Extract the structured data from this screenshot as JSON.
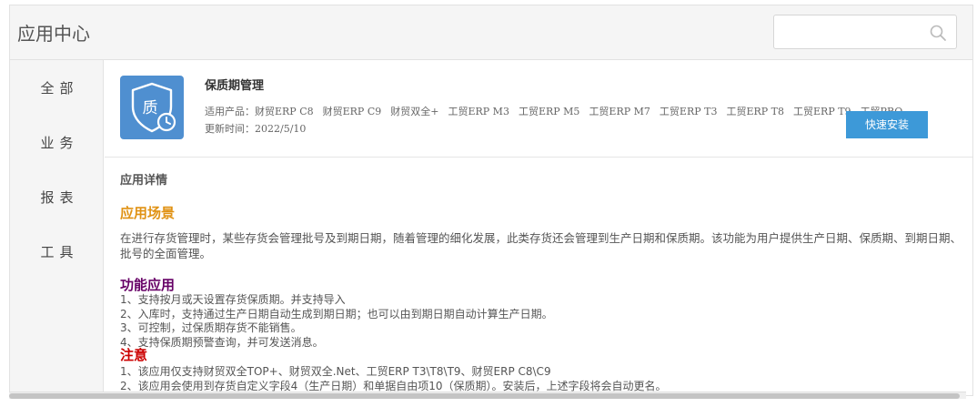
{
  "header": {
    "title": "应用中心",
    "search_placeholder": ""
  },
  "sidebar": {
    "items": [
      {
        "label": "全部"
      },
      {
        "label": "业务"
      },
      {
        "label": "报表"
      },
      {
        "label": "工具"
      }
    ]
  },
  "app": {
    "icon_char": "质",
    "name": "保质期管理",
    "products_label": "适用产品：",
    "products": [
      "财贸ERP C8",
      "财贸ERP C9",
      "财贸双全+",
      "工贸ERP M3",
      "工贸ERP M5",
      "工贸ERP M7",
      "工贸ERP T3",
      "工贸ERP T8",
      "工贸ERP T9",
      "工贸PRO"
    ],
    "update_label": "更新时间：",
    "update_date": "2022/5/10",
    "install_label": "快速安装"
  },
  "detail": {
    "heading": "应用详情",
    "scene_heading": "应用场景",
    "scene_text": "在进行存货管理时，某些存货会管理批号及到期日期，随着管理的细化发展，此类存货还会管理到生产日期和保质期。该功能为用户提供生产日期、保质期、到期日期、批号的全面管理。",
    "function_heading": "功能应用",
    "function_items": [
      "1、支持按月或天设置存货保质期。并支持导入",
      "2、入库时，支持通过生产日期自动生成到期日期；也可以由到期日期自动计算生产日期。",
      "3、可控制，过保质期存货不能销售。",
      "4、支持保质期预警查询，并可发送消息。"
    ],
    "note_heading": "注意",
    "note_items": [
      "1、该应用仅支持财贸双全TOP+、财贸双全.Net、工贸ERP T3\\T8\\T9、财贸ERP C8\\C9",
      "2、该应用会使用到存货自定义字段4（生产日期）和单据自由项10（保质期）。安装后，上述字段将会自动更名。"
    ]
  },
  "colors": {
    "accent": "#3d99d8",
    "icon_bg": "#4f8fd0",
    "scene_heading": "#e09214",
    "function_heading": "#660066",
    "note_heading": "#cc0000"
  }
}
